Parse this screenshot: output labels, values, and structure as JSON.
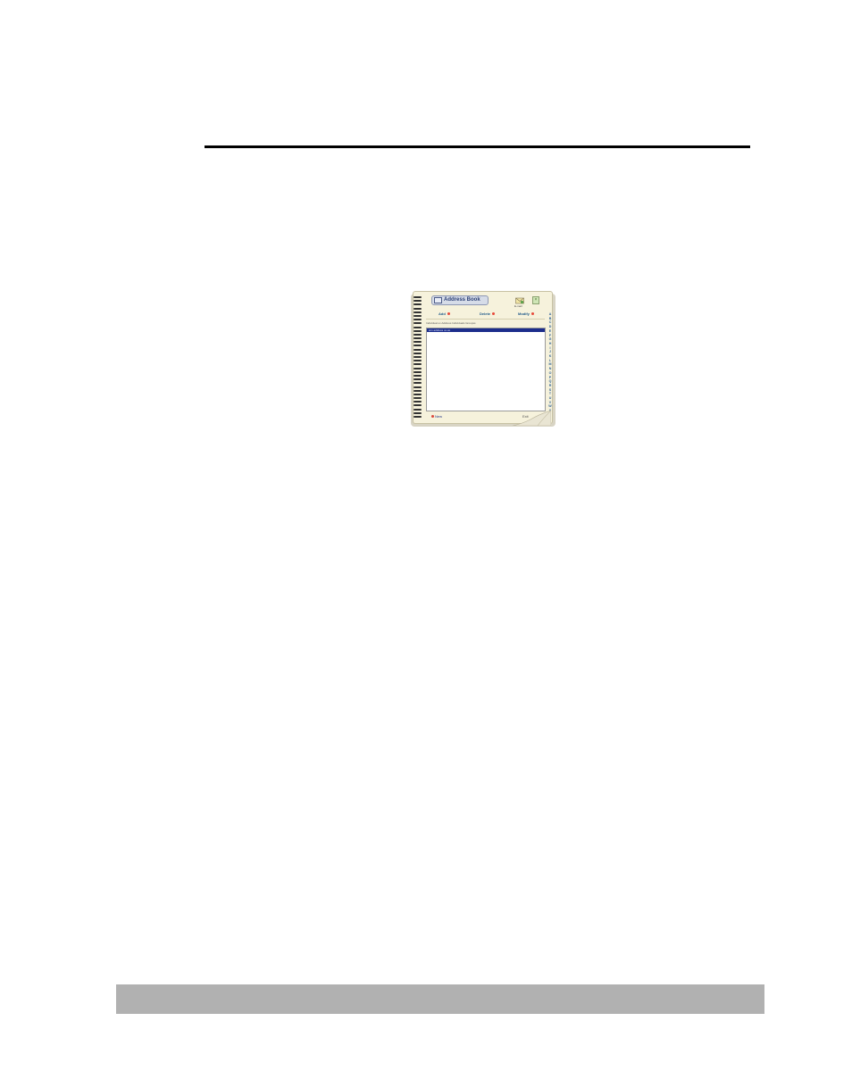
{
  "screenshot": {
    "title": "Address Book",
    "email_label": "E-mail",
    "toolbar": {
      "add": "Add",
      "delete": "Delete",
      "modify": "Modify"
    },
    "list_header": "Individual      ox Address Individuals Groupss",
    "list": {
      "selected_row": "wm  address  ox.ax"
    },
    "alphabet": [
      "A",
      "B",
      "C",
      "D",
      "E",
      "F",
      "G",
      "H",
      "I",
      "J",
      "K",
      "L",
      "M",
      "N",
      "O",
      "P",
      "Q",
      "R",
      "S",
      "T",
      "U",
      "V",
      "W",
      "X",
      "Y",
      "Z"
    ],
    "new_button": "New",
    "exit_label": "Exit"
  },
  "colors": {
    "page": "#f6f2dc",
    "selection": "#1c2d8c",
    "footer_bar": "#b1b1b1"
  }
}
